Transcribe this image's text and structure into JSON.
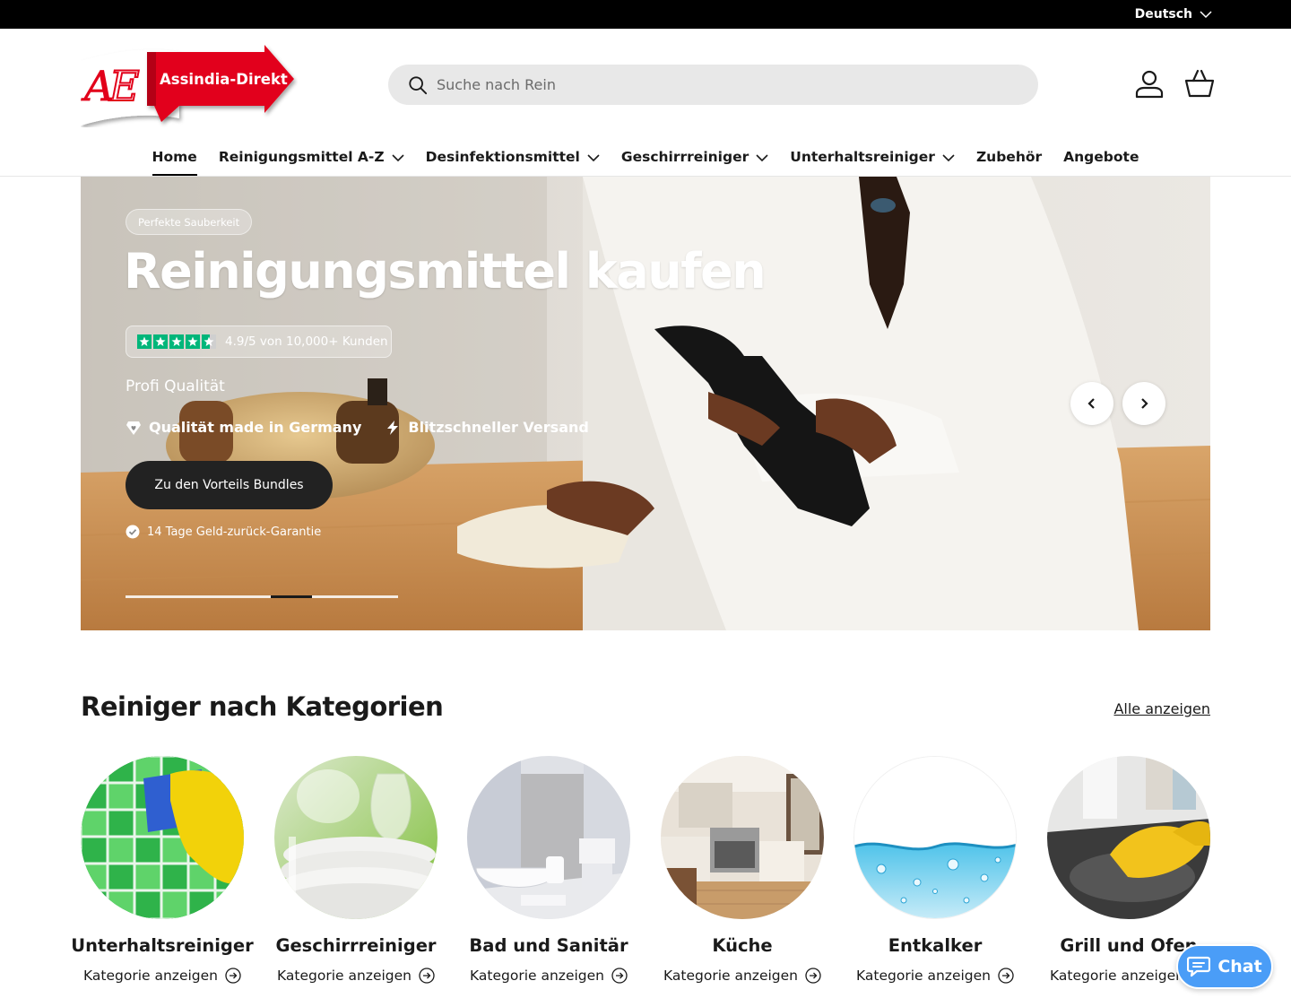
{
  "topbar": {
    "language": "Deutsch"
  },
  "header": {
    "logo_text": "Assindia-Direkt",
    "logo_mark": "AE",
    "search_placeholder": "Suche nach Rein",
    "account_icon": "user-icon",
    "cart_icon": "basket-icon"
  },
  "nav": {
    "items": [
      {
        "label": "Home",
        "dropdown": false,
        "active": true
      },
      {
        "label": "Reinigungsmittel A-Z",
        "dropdown": true
      },
      {
        "label": "Desinfektionsmittel",
        "dropdown": true
      },
      {
        "label": "Geschirrreiniger",
        "dropdown": true
      },
      {
        "label": "Unterhaltsreiniger",
        "dropdown": true
      },
      {
        "label": "Zubehör",
        "dropdown": false
      },
      {
        "label": "Angebote",
        "dropdown": false
      }
    ]
  },
  "hero": {
    "badge": "Perfekte Sauberkeit",
    "title": "Reinigungsmittel kaufen",
    "rating_text": "4.9/5 von 10,000+ Kunden",
    "rating_stars": 4.5,
    "subline": "Profi Qualität",
    "features": [
      "Qualität made in Germany",
      "Blitzschneller Versand"
    ],
    "cta": "Zu den Vorteils Bundles",
    "guarantee": "14 Tage Geld-zurück-Garantie",
    "slide_progress": {
      "current": 2,
      "total": 3
    }
  },
  "categories": {
    "title": "Reiniger nach Kategorien",
    "view_all": "Alle anzeigen",
    "link_label": "Kategorie anzeigen",
    "items": [
      {
        "name": "Unterhaltsreiniger"
      },
      {
        "name": "Geschirrreiniger"
      },
      {
        "name": "Bad und Sanitär"
      },
      {
        "name": "Küche"
      },
      {
        "name": "Entkalker"
      },
      {
        "name": "Grill und Ofen"
      }
    ]
  },
  "chat": {
    "label": "Chat"
  },
  "colors": {
    "accent_chat": "#4a9df7",
    "trustpilot_green": "#00b67a",
    "logo_red": "#e2001a"
  }
}
